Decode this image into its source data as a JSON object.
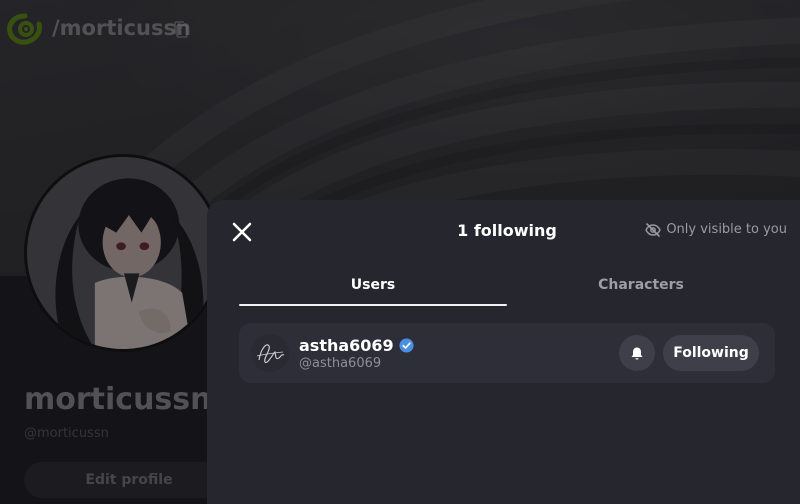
{
  "profile": {
    "handle": "/morticussn",
    "display_name": "morticussn",
    "sub_handle": "@morticussn",
    "edit_profile_label": "Edit profile"
  },
  "modal": {
    "title": "1 following",
    "visibility_text": "Only visible to you",
    "tabs": [
      {
        "label": "Users",
        "active": true
      },
      {
        "label": "Characters",
        "active": false
      }
    ],
    "users": [
      {
        "name": "astha6069",
        "handle": "@astha6069",
        "verified": true,
        "follow_button_label": "Following"
      }
    ]
  },
  "icons": {
    "close": "close-icon",
    "visibility": "eye-off-icon",
    "verified": "verified-badge-icon",
    "notification": "bell-icon",
    "copy": "copy-icon",
    "logo": "site-logo"
  },
  "colors": {
    "modal_bg": "#26262f",
    "row_bg": "#2e2e38",
    "button_bg": "#3f3f4a",
    "verified_blue": "#4a90e2",
    "logo_green": "#6b8f1a"
  }
}
